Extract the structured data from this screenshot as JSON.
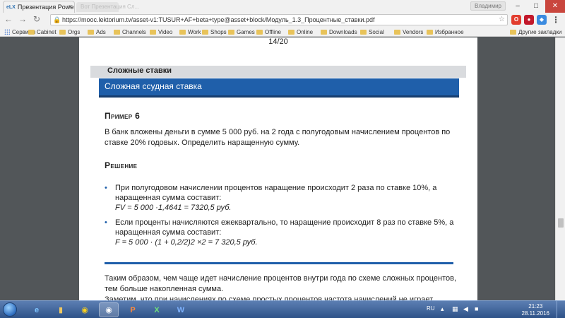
{
  "browser": {
    "active_tab_title": "Презентация PowerPoi",
    "active_tab_favicon": "eLX",
    "inactive_tab_title": "Вот Презентация Сл...",
    "user_name": "Владимир",
    "url": "https://mooc.lektorium.tv/asset-v1:TUSUR+AF+beta+type@asset+block/Модуль_1.3_Процентные_ставки.pdf",
    "icons": {
      "back": "back-arrow-icon",
      "forward": "forward-arrow-icon",
      "reload": "reload-icon",
      "lock": "secure-lock-icon",
      "star": "bookmark-star-icon"
    }
  },
  "bookmarks": {
    "apps_label": "Сервисы",
    "items": [
      "Cabinet",
      "Orgs",
      "Ads",
      "Channels",
      "Video",
      "Work",
      "Shops",
      "Games",
      "Offline",
      "Online",
      "Downloads",
      "Social",
      "Vendors",
      "Избранное"
    ],
    "other_label": "Другие закладки"
  },
  "pdf": {
    "page_counter": "14/20",
    "section_title": "Сложные ставки",
    "topic_title": "Сложная ссудная ставка",
    "example_heading": "Пример 6",
    "task_text": "В банк вложены деньги в сумме 5 000 руб. на 2 года с полугодовым начислением процентов по ставке 20% годовых. Определить наращенную сумму.",
    "solution_heading": "Решение",
    "bullets": [
      {
        "text": "При полугодовом начислении процентов наращение происходит 2 раза по ставке 10%, а наращенная сумма составит:",
        "formula": "FV = 5 000 ·1,4641 = 7320,5 руб."
      },
      {
        "text": "Если проценты начисляются ежеквартально, то наращение происходит 8 раз по ставке 5%, а наращенная сумма составит:",
        "formula": "F = 5 000 · (1 + 0,2/2)2 ×2 = 7 320,5 руб."
      }
    ],
    "conclusion_text": "Таким образом, чем чаще идет начисление процентов внутри года по схеме сложных процентов, тем больше накопленная сумма.",
    "conclusion_cut": "Заметим, что при начислениях по схеме простых процентов частота начислений не играет"
  },
  "taskbar": {
    "language": "RU",
    "time": "21:23",
    "date": "28.11.2016",
    "colors": {
      "accent_blue": "#1f5faa",
      "chrome_close": "#c9463d"
    }
  }
}
